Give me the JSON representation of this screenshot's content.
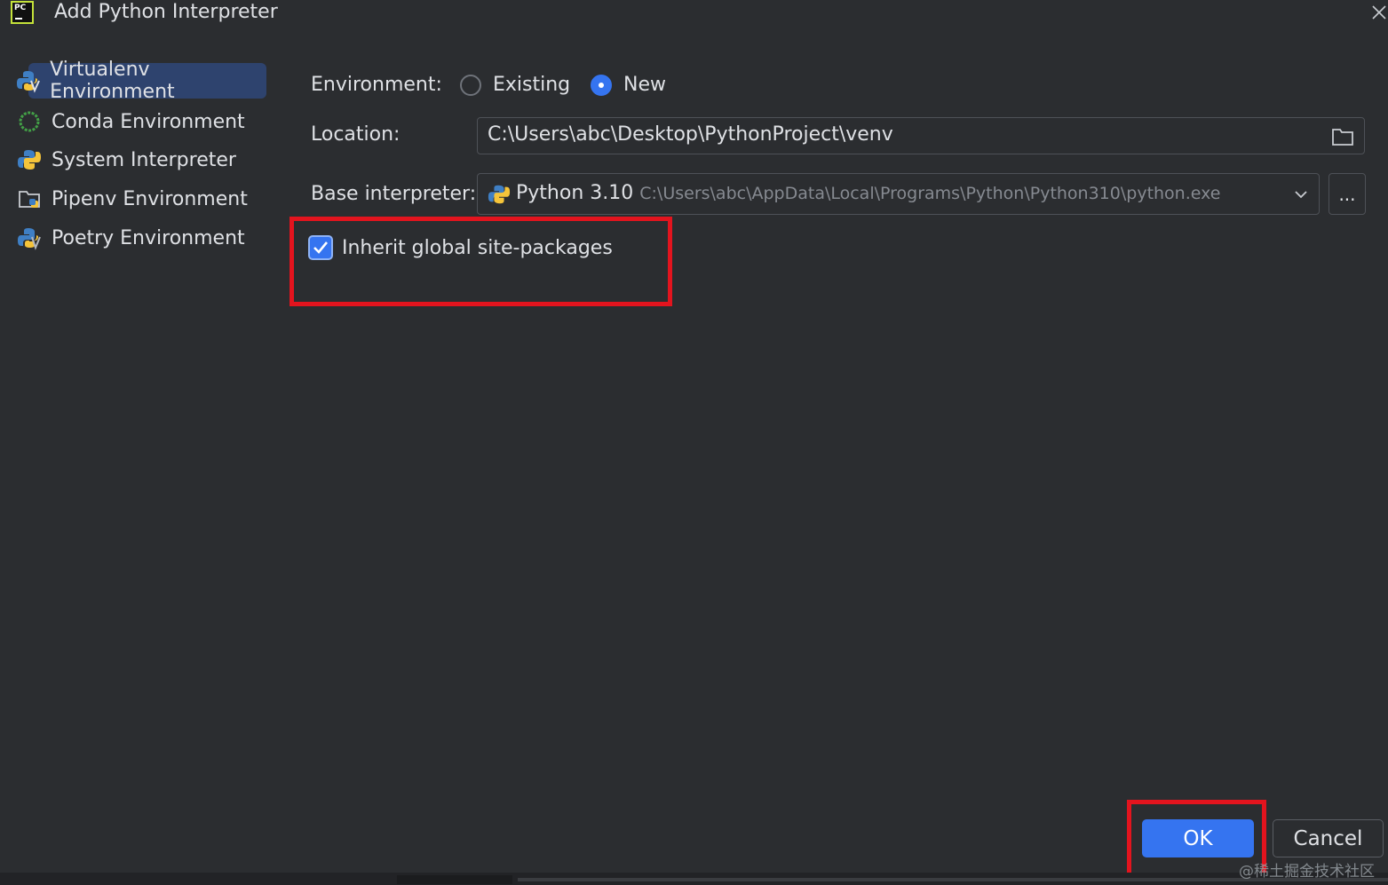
{
  "window": {
    "title": "Add Python Interpreter",
    "app_icon_text": "PC"
  },
  "sidebar": {
    "items": [
      {
        "label": "Virtualenv Environment",
        "icon": "virtualenv-icon",
        "selected": true
      },
      {
        "label": "Conda Environment",
        "icon": "conda-icon",
        "selected": false
      },
      {
        "label": "System Interpreter",
        "icon": "python-icon",
        "selected": false
      },
      {
        "label": "Pipenv Environment",
        "icon": "pipenv-folder-icon",
        "selected": false
      },
      {
        "label": "Poetry Environment",
        "icon": "poetry-icon",
        "selected": false
      }
    ]
  },
  "form": {
    "environment": {
      "label": "Environment:",
      "options": [
        "Existing",
        "New"
      ],
      "selected": "New"
    },
    "location": {
      "label": "Location:",
      "value": "C:\\Users\\abc\\Desktop\\PythonProject\\venv",
      "icon": "folder-icon"
    },
    "base_interpreter": {
      "label": "Base interpreter:",
      "name": "Python 3.10",
      "path": "C:\\Users\\abc\\AppData\\Local\\Programs\\Python\\Python310\\python.exe",
      "browse_label": "..."
    },
    "inherit": {
      "label": "Inherit global site-packages",
      "checked": true
    }
  },
  "footer": {
    "ok_label": "OK",
    "cancel_label": "Cancel"
  },
  "watermark": "@稀土掘金技术社区",
  "colors": {
    "accent": "#3574f0",
    "highlight": "#e3141e",
    "background": "#2b2d30",
    "selection": "#2e436e"
  }
}
